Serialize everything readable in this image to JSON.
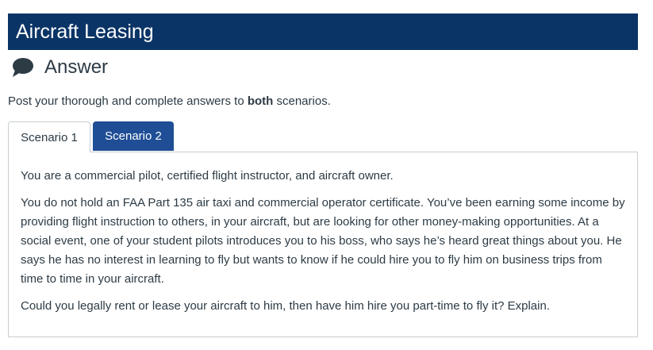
{
  "banner": {
    "title": "Aircraft Leasing"
  },
  "answer": {
    "icon": "speech-bubble-icon",
    "heading": "Answer"
  },
  "instructions": {
    "before": "Post your thorough and complete answers to ",
    "bold": "both",
    "after": " scenarios."
  },
  "tabs": [
    {
      "label": "Scenario 1",
      "active": true
    },
    {
      "label": "Scenario 2",
      "active": false
    }
  ],
  "scenario1": {
    "paragraphs": [
      "You are a commercial pilot, certified flight instructor, and aircraft owner.",
      "You do not hold an FAA Part 135 air taxi and commercial operator certificate. You’ve been earning some income by providing flight instruction to others, in your aircraft, but are looking for other money-making opportunities. At a social event, one of your student pilots introduces you to his boss, who says he’s heard great things about you. He says he has no interest in learning to fly but wants to know if he could hire you to fly him on business trips from time to time in your aircraft.",
      "Could you legally rent or lease your aircraft to him, then have him hire you part-time to fly it? Explain."
    ]
  },
  "colors": {
    "banner_bg": "#0b3466",
    "active_tab_bg": "#ffffff",
    "inactive_tab_bg": "#1f4e96",
    "text": "#2d3b45",
    "border": "#c7cdd1"
  }
}
